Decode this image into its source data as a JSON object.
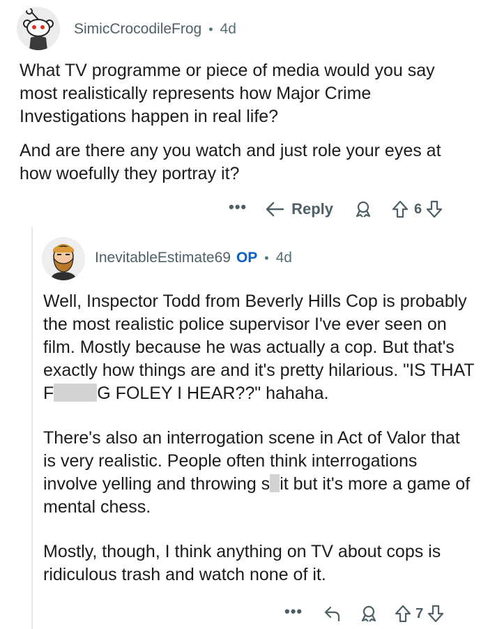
{
  "parent_comment": {
    "author": "SimicCrocodileFrog",
    "separator": "•",
    "time": "4d",
    "paragraphs": [
      "What TV programme or piece of media would you say most realistically represents how Major Crime Investigations happen in real life?",
      "And are there any you watch and just role your eyes at how woefully they portray it?"
    ],
    "actions": {
      "more_label": "•••",
      "reply_label": "Reply",
      "vote_count": "6"
    }
  },
  "reply_comment": {
    "author": "InevitableEstimate69",
    "op_badge": "OP",
    "separator": "•",
    "time": "4d",
    "p1_a": "Well, Inspector Todd from Beverly Hills Cop is probably the most realistic police supervisor I've ever seen on film. Mostly because he was actually a cop. But that's exactly how things are and it's pretty hilarious. \"IS THAT F",
    "p1_b": "G FOLEY I HEAR??\" hahaha.",
    "p2_a": "There's also an interrogation scene in Act of Valor that is very realistic. People often think interrogations involve yelling and throwing s",
    "p2_b": "it but it's more a game of mental chess.",
    "p3": "Mostly, though, I think anything on TV about cops is ridiculous trash and watch none of it.",
    "actions": {
      "more_label": "•••",
      "vote_count": "7"
    }
  },
  "icons": {
    "parent_avatar": "reddit-snoo-avatar-icon",
    "reply_avatar": "bearded-man-avatar-icon",
    "reply": "reply-arrow-icon",
    "award": "award-icon",
    "upvote": "upvote-arrow-icon",
    "downvote": "downvote-arrow-icon"
  },
  "colors": {
    "meta_text": "#576f76",
    "op_badge": "#0a5fc8",
    "thread_line": "#e5e7e8",
    "redaction": "#d3d3d3"
  }
}
